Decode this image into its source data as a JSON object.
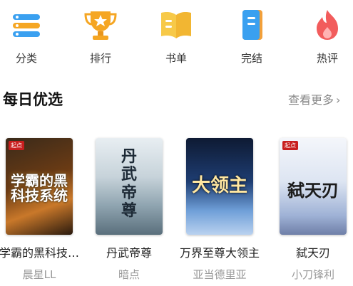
{
  "nav": [
    {
      "label": "分类",
      "icon": "category-icon"
    },
    {
      "label": "排行",
      "icon": "trophy-icon"
    },
    {
      "label": "书单",
      "icon": "book-list-icon"
    },
    {
      "label": "完结",
      "icon": "completed-book-icon"
    },
    {
      "label": "热评",
      "icon": "hot-comment-icon"
    }
  ],
  "section": {
    "title": "每日优选",
    "more_label": "查看更多"
  },
  "books": [
    {
      "title": "学霸的黑科技…",
      "author": "晨星LL",
      "cover_text": "学霸的黑科技系统"
    },
    {
      "title": "丹武帝尊",
      "author": "暗点",
      "cover_text": "丹武帝尊"
    },
    {
      "title": "万界至尊大领主",
      "author": "亚当德里亚",
      "cover_text": "大领主"
    },
    {
      "title": "弑天刃",
      "author": "小刀锋利",
      "cover_text": "弑天刃"
    }
  ],
  "colors": {
    "category": "#3aa0f0",
    "trophy": "#f5a623",
    "booklist": "#f7c948",
    "completed": "#f2a03a",
    "hot": "#f25c5c"
  }
}
